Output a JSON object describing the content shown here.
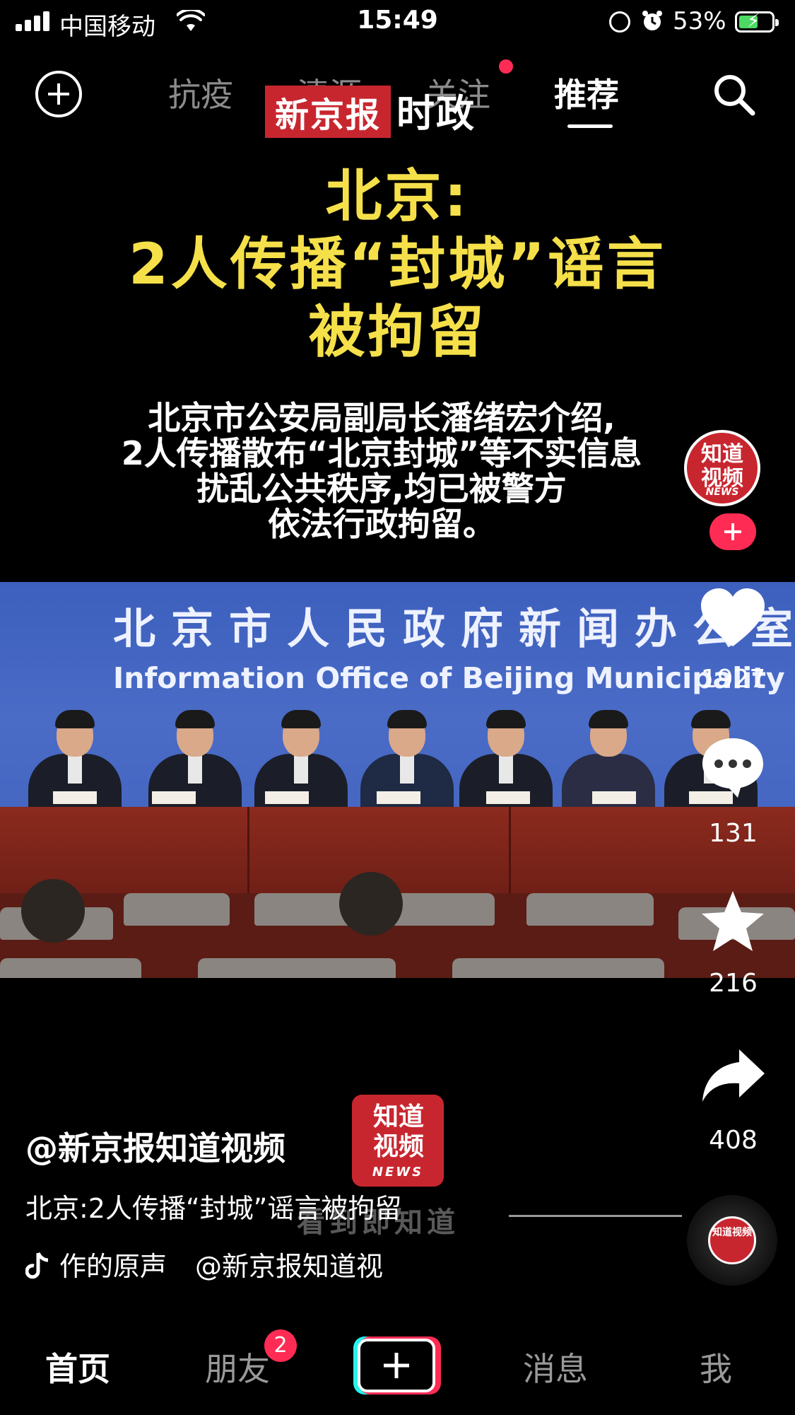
{
  "status_bar": {
    "carrier": "中国移动",
    "time": "15:49",
    "battery_percent": "53%",
    "signal_bars": 4
  },
  "top_nav": {
    "tabs": [
      {
        "label": "抗疫",
        "active": false
      },
      {
        "label": "清源",
        "active": false
      },
      {
        "label": "关注",
        "active": false,
        "has_dot": true
      },
      {
        "label": "推荐",
        "active": true
      }
    ],
    "icons": {
      "left": "add-circle-icon",
      "right": "search-icon"
    }
  },
  "video": {
    "brand_red": "新京报",
    "brand_white": "时政",
    "headline_lines": [
      "北京:",
      "2人传播“封城”谣言",
      "被拘留"
    ],
    "summary_lines": [
      "北京市公安局副局长潘绪宏介绍,",
      "2人传播散布“北京封城”等不实信息",
      "扰乱公共秩序,均已被警方",
      "依法行政拘留。"
    ],
    "backdrop_cn": "北京市人民政府新闻办公室",
    "backdrop_en": "Information Office of Beijing Municipality",
    "watermark_logo": {
      "text": "知道视频",
      "news": "NEWS"
    },
    "ghost_text": "看到即知道"
  },
  "rail": {
    "avatar": {
      "text": "知道视频",
      "news": "NEWS"
    },
    "likes": "1927",
    "comments": "131",
    "favorites": "216",
    "shares": "408",
    "colors": {
      "accent": "#fe2c55",
      "brand_red": "#c8262f"
    }
  },
  "caption": {
    "author": "@新京报知道视频",
    "text": "北京:2人传播“封城”谣言被拘留",
    "music_source": "作的原声",
    "music_author": "@新京报知道视"
  },
  "tabbar": {
    "home": "首页",
    "friends": "朋友",
    "friends_badge": "2",
    "messages": "消息",
    "me": "我"
  }
}
